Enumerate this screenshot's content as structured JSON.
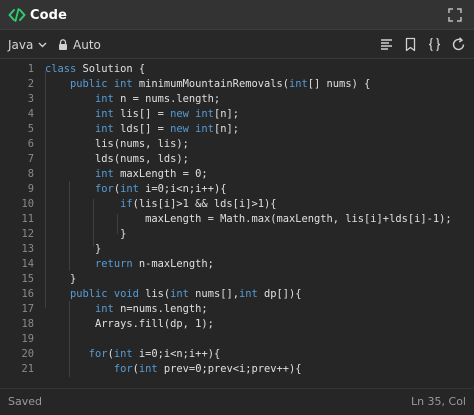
{
  "title_bar": {
    "title": "Code",
    "brand_icon": "code-brackets-icon",
    "brand_color": "#2ecc71",
    "expand_icon": "expand-icon"
  },
  "toolbar": {
    "language": "Java",
    "mode": "Auto",
    "icons": [
      "format-lines-icon",
      "bookmark-icon",
      "braces-icon",
      "reset-icon"
    ]
  },
  "editor": {
    "colors": {
      "keyword": "#569cd6",
      "text": "#e0e0e0",
      "line_number": "#8a8a8a"
    },
    "lines": [
      {
        "n": "1",
        "tokens": [
          [
            "kw",
            "class"
          ],
          [
            "pl",
            " Solution {"
          ]
        ]
      },
      {
        "n": "2",
        "tokens": [
          [
            "pl",
            "    "
          ],
          [
            "kw",
            "public int"
          ],
          [
            "pl",
            " minimumMountainRemovals("
          ],
          [
            "kw",
            "int"
          ],
          [
            "pl",
            "[] nums) {"
          ]
        ]
      },
      {
        "n": "3",
        "tokens": [
          [
            "pl",
            "        "
          ],
          [
            "kw",
            "int"
          ],
          [
            "pl",
            " n = nums.length;"
          ]
        ]
      },
      {
        "n": "4",
        "tokens": [
          [
            "pl",
            "        "
          ],
          [
            "kw",
            "int"
          ],
          [
            "pl",
            " lis[] = "
          ],
          [
            "kw",
            "new int"
          ],
          [
            "pl",
            "[n];"
          ]
        ]
      },
      {
        "n": "5",
        "tokens": [
          [
            "pl",
            "        "
          ],
          [
            "kw",
            "int"
          ],
          [
            "pl",
            " lds[] = "
          ],
          [
            "kw",
            "new int"
          ],
          [
            "pl",
            "[n];"
          ]
        ]
      },
      {
        "n": "6",
        "tokens": [
          [
            "pl",
            "        lis(nums, lis);"
          ]
        ]
      },
      {
        "n": "7",
        "tokens": [
          [
            "pl",
            "        lds(nums, lds);"
          ]
        ]
      },
      {
        "n": "8",
        "tokens": [
          [
            "pl",
            "        "
          ],
          [
            "kw",
            "int"
          ],
          [
            "pl",
            " maxLength = 0;"
          ]
        ]
      },
      {
        "n": "9",
        "tokens": [
          [
            "pl",
            "        "
          ],
          [
            "kw",
            "for"
          ],
          [
            "pl",
            "("
          ],
          [
            "kw",
            "int"
          ],
          [
            "pl",
            " i=0;i<n;i++){"
          ]
        ]
      },
      {
        "n": "10",
        "tokens": [
          [
            "pl",
            "            "
          ],
          [
            "kw",
            "if"
          ],
          [
            "pl",
            "(lis[i]>1 && lds[i]>1){"
          ]
        ]
      },
      {
        "n": "11",
        "tokens": [
          [
            "pl",
            "                maxLength = Math.max(maxLength, lis[i]+lds[i]-1);"
          ]
        ]
      },
      {
        "n": "12",
        "tokens": [
          [
            "pl",
            "            }"
          ]
        ]
      },
      {
        "n": "13",
        "tokens": [
          [
            "pl",
            "        }"
          ]
        ]
      },
      {
        "n": "14",
        "tokens": [
          [
            "pl",
            "        "
          ],
          [
            "kw",
            "return"
          ],
          [
            "pl",
            " n-maxLength;"
          ]
        ]
      },
      {
        "n": "15",
        "tokens": [
          [
            "pl",
            "    }"
          ]
        ]
      },
      {
        "n": "16",
        "tokens": [
          [
            "pl",
            "    "
          ],
          [
            "kw",
            "public void"
          ],
          [
            "pl",
            " lis("
          ],
          [
            "kw",
            "int"
          ],
          [
            "pl",
            " nums[],"
          ],
          [
            "kw",
            "int"
          ],
          [
            "pl",
            " dp[]){"
          ]
        ]
      },
      {
        "n": "17",
        "tokens": [
          [
            "pl",
            "        "
          ],
          [
            "kw",
            "int"
          ],
          [
            "pl",
            " n=nums.length;"
          ]
        ]
      },
      {
        "n": "18",
        "tokens": [
          [
            "pl",
            "        Arrays.fill(dp, 1);"
          ]
        ]
      },
      {
        "n": "19",
        "tokens": []
      },
      {
        "n": "20",
        "tokens": [
          [
            "pl",
            "       "
          ],
          [
            "kw",
            "for"
          ],
          [
            "pl",
            "("
          ],
          [
            "kw",
            "int"
          ],
          [
            "pl",
            " i=0;i<n;i++){"
          ]
        ]
      },
      {
        "n": "21",
        "tokens": [
          [
            "pl",
            "           "
          ],
          [
            "kw",
            "for"
          ],
          [
            "pl",
            "("
          ],
          [
            "kw",
            "int"
          ],
          [
            "pl",
            " prev=0;prev<i;prev++){"
          ]
        ]
      }
    ]
  },
  "status_bar": {
    "left": "Saved",
    "right": "Ln 35, Col"
  }
}
